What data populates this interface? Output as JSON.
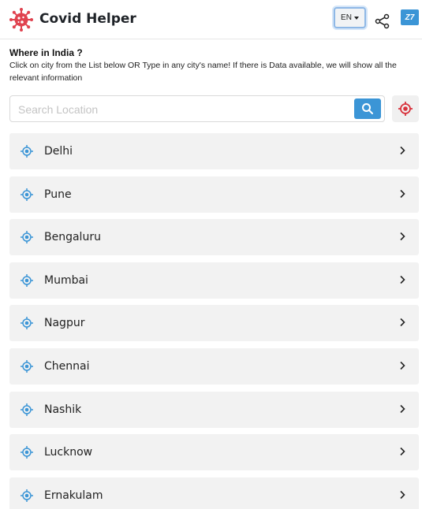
{
  "header": {
    "app_title": "Covid Helper",
    "lang_label": "EN",
    "brand_badge": "Z7",
    "logo_icon": "virus-icon",
    "share_icon": "share-icon",
    "accent_color": "#3b95d6",
    "logo_color": "#e0424f"
  },
  "intro": {
    "title": "Where in India ?",
    "description": "Click on city from the List below OR Type in any city's name! If there is Data available, we will show all the relevant information"
  },
  "search": {
    "placeholder": "Search Location",
    "value": "",
    "search_icon": "search-icon",
    "locate_icon": "crosshair-icon"
  },
  "cities": [
    {
      "name": "Delhi"
    },
    {
      "name": "Pune"
    },
    {
      "name": "Bengaluru"
    },
    {
      "name": "Mumbai"
    },
    {
      "name": "Nagpur"
    },
    {
      "name": "Chennai"
    },
    {
      "name": "Nashik"
    },
    {
      "name": "Lucknow"
    },
    {
      "name": "Ernakulam"
    }
  ]
}
